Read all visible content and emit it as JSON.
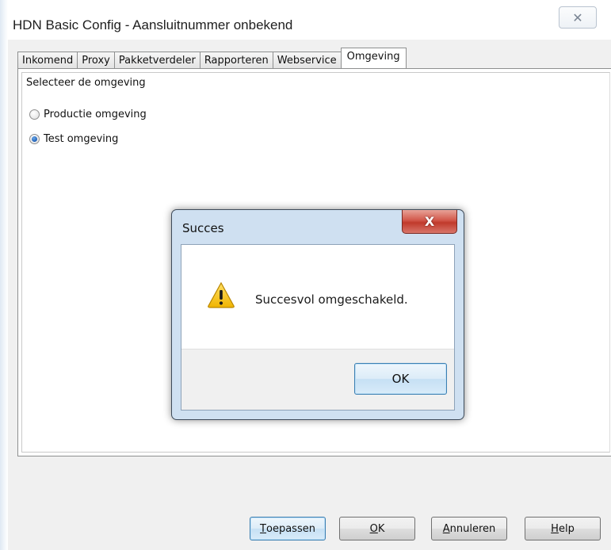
{
  "window": {
    "title": "HDN Basic Config - Aansluitnummer onbekend",
    "close_glyph": "✕"
  },
  "tabs": [
    {
      "label": "Inkomend",
      "active": false
    },
    {
      "label": "Proxy",
      "active": false
    },
    {
      "label": "Pakketverdeler",
      "active": false
    },
    {
      "label": "Rapporteren",
      "active": false
    },
    {
      "label": "Webservice",
      "active": false
    },
    {
      "label": "Omgeving",
      "active": true
    }
  ],
  "environment": {
    "group_label": "Selecteer de omgeving",
    "options": [
      {
        "label": "Productie omgeving",
        "checked": false
      },
      {
        "label": "Test omgeving",
        "checked": true
      }
    ]
  },
  "dialog": {
    "title": "Succes",
    "close_glyph": "X",
    "icon": "warning-icon",
    "message": "Succesvol omgeschakeld.",
    "ok_label": "OK"
  },
  "buttons": {
    "apply": {
      "mnemonic": "T",
      "rest": "oepassen"
    },
    "ok": {
      "mnemonic": "O",
      "rest": "K"
    },
    "cancel": {
      "mnemonic": "A",
      "rest": "nnuleren"
    },
    "help": {
      "mnemonic": "H",
      "rest": "elp"
    }
  },
  "colors": {
    "accent_blue": "#3c7fb1",
    "dialog_close_red": "#c0392b",
    "warning_yellow": "#f5c400"
  }
}
